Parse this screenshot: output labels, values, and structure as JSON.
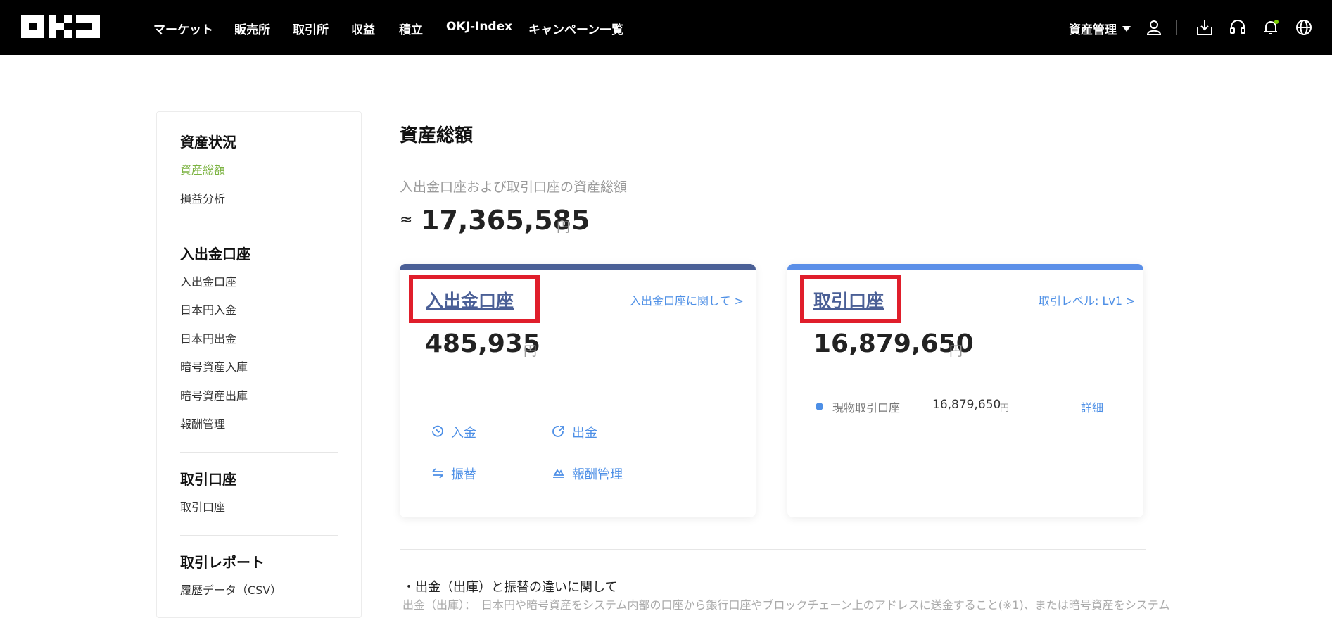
{
  "brand": {
    "logo_text": "OKJ"
  },
  "topnav": {
    "items": [
      "マーケット",
      "販売所",
      "取引所",
      "収益",
      "積立",
      "OKJ-Index",
      "キャンペーン一覧"
    ],
    "asset_menu_label": "資産管理"
  },
  "sidebar": {
    "sections": [
      {
        "heading": "資産状況",
        "items": [
          "資産総額",
          "損益分析"
        ]
      },
      {
        "heading": "入出金口座",
        "items": [
          "入出金口座",
          "日本円入金",
          "日本円出金",
          "暗号資産入庫",
          "暗号資産出庫",
          "報酬管理"
        ]
      },
      {
        "heading": "取引口座",
        "items": [
          "取引口座"
        ]
      },
      {
        "heading": "取引レポート",
        "items": [
          "履歴データ（CSV）"
        ]
      }
    ],
    "active_item": "資産総額"
  },
  "main": {
    "title": "資産総額",
    "total_label": "入出金口座および取引口座の資産総額",
    "approx_symbol": "≈",
    "total_value": "17,365,585",
    "currency": "円",
    "funding_card": {
      "title": "入出金口座",
      "link": "入出金口座に関して >",
      "amount": "485,935",
      "actions": [
        "入金",
        "出金",
        "振替",
        "報酬管理"
      ],
      "accent_color": "#4a5f96"
    },
    "trading_card": {
      "title": "取引口座",
      "link": "取引レベル: Lv1 >",
      "amount": "16,879,650",
      "sub_account_label": "現物取引口座",
      "sub_account_value": "16,879,650",
      "detail_link": "詳細",
      "accent_color": "#5b8fe8"
    },
    "note_heading": "・出金（出庫）と振替の違いに関して",
    "note_text": "出金（出庫）：　日本円や暗号資産をシステム内部の口座から銀行口座やブロックチェーン上のアドレスに送金すること(※1)、または暗号資産をシステム"
  },
  "colors": {
    "highlight": "#e01e2b",
    "link": "#4d8fe6",
    "active": "#7cb342"
  }
}
